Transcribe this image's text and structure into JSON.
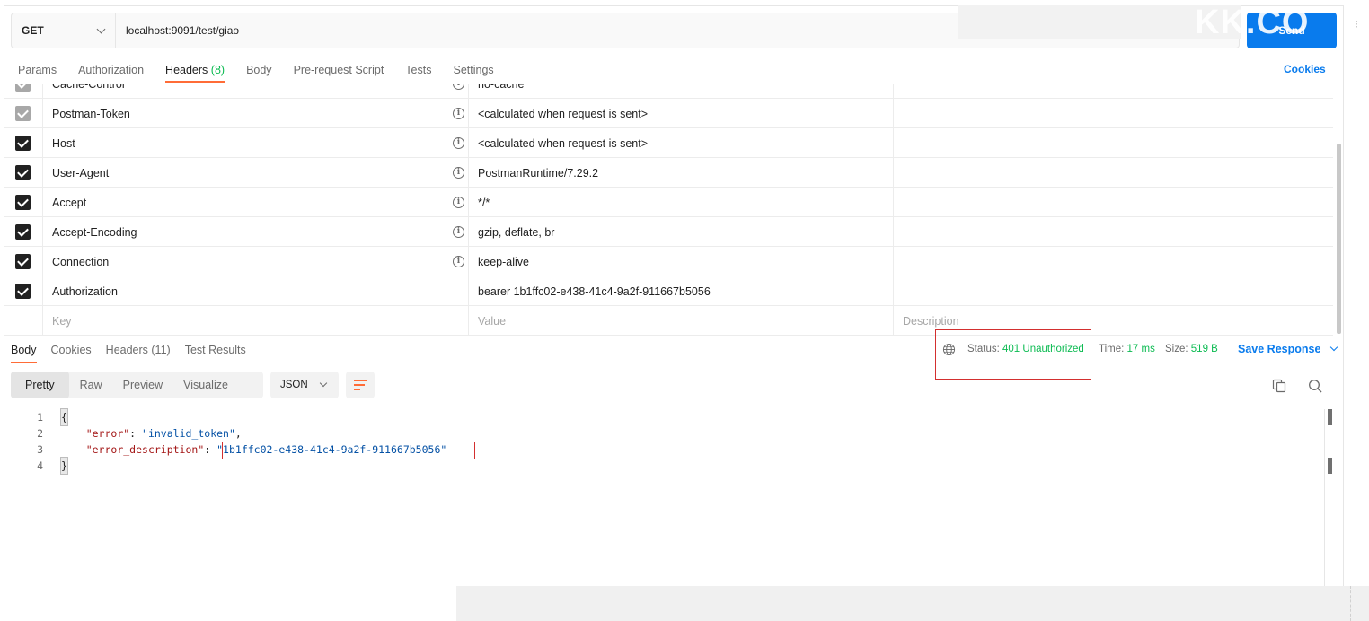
{
  "request": {
    "method": "GET",
    "url": "localhost:9091/test/giao",
    "send_label": "Send",
    "watermark": "KK.CO"
  },
  "request_tabs": [
    {
      "label": "Params"
    },
    {
      "label": "Authorization"
    },
    {
      "label": "Headers",
      "count": "(8)"
    },
    {
      "label": "Body"
    },
    {
      "label": "Pre-request Script"
    },
    {
      "label": "Tests"
    },
    {
      "label": "Settings"
    }
  ],
  "cookies_label": "Cookies",
  "headers": {
    "rows": [
      {
        "key": "Cache-Control",
        "value": "no-cache",
        "info": true,
        "disabled": true
      },
      {
        "key": "Postman-Token",
        "value": "<calculated when request is sent>",
        "info": true,
        "disabled": true
      },
      {
        "key": "Host",
        "value": "<calculated when request is sent>",
        "info": true,
        "disabled": false
      },
      {
        "key": "User-Agent",
        "value": "PostmanRuntime/7.29.2",
        "info": true,
        "disabled": false
      },
      {
        "key": "Accept",
        "value": "*/*",
        "info": true,
        "disabled": false
      },
      {
        "key": "Accept-Encoding",
        "value": "gzip, deflate, br",
        "info": true,
        "disabled": false
      },
      {
        "key": "Connection",
        "value": "keep-alive",
        "info": true,
        "disabled": false
      },
      {
        "key": "Authorization",
        "value": "bearer 1b1ffc02-e438-41c4-9a2f-911667b5056",
        "info": false,
        "disabled": false
      }
    ],
    "placeholder": {
      "key": "Key",
      "value": "Value",
      "description": "Description"
    }
  },
  "response_tabs": [
    {
      "label": "Body"
    },
    {
      "label": "Cookies"
    },
    {
      "label": "Headers (11)"
    },
    {
      "label": "Test Results"
    }
  ],
  "response_meta": {
    "status_label": "Status:",
    "status_value": "401 Unauthorized",
    "time_label": "Time:",
    "time_value": "17 ms",
    "size_label": "Size:",
    "size_value": "519 B",
    "save_label": "Save Response"
  },
  "view_modes": [
    "Pretty",
    "Raw",
    "Preview",
    "Visualize"
  ],
  "format": "JSON",
  "code_lines": [
    {
      "num": "1",
      "parts": [
        {
          "t": "{",
          "c": "p",
          "brace": true
        }
      ]
    },
    {
      "num": "2",
      "parts": [
        {
          "t": "    ",
          "c": "p"
        },
        {
          "t": "\"error\"",
          "c": "k"
        },
        {
          "t": ": ",
          "c": "p"
        },
        {
          "t": "\"invalid_token\"",
          "c": "s"
        },
        {
          "t": ",",
          "c": "p"
        }
      ]
    },
    {
      "num": "3",
      "parts": [
        {
          "t": "    ",
          "c": "p"
        },
        {
          "t": "\"error_description\"",
          "c": "k"
        },
        {
          "t": ": ",
          "c": "p"
        },
        {
          "t": "\"1b1ffc02-e438-41c4-9a2f-911667b5056\"",
          "c": "s"
        }
      ]
    },
    {
      "num": "4",
      "parts": [
        {
          "t": "}",
          "c": "p",
          "brace": true
        }
      ]
    }
  ],
  "colors": {
    "accent": "#ff6c37",
    "link": "#097bed",
    "status_ok": "#0cbb52",
    "highlight_box": "#d32f2f"
  }
}
